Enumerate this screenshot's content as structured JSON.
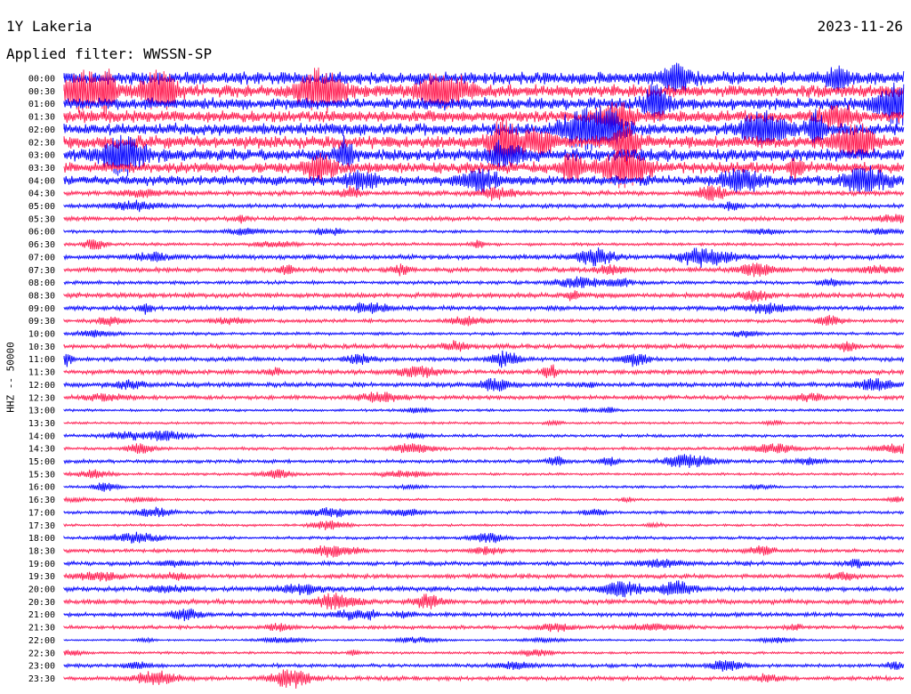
{
  "header": {
    "station": "1Y Lakeria",
    "date": "2023-11-26",
    "filter_label": "Applied filter: WWSSN-SP"
  },
  "colors": {
    "series_a": "#0000ff",
    "series_b": "#ff1a4f",
    "text": "#000000"
  },
  "chart_data": {
    "type": "line",
    "title": "1Y Lakeria",
    "subtitle": "Applied filter: WWSSN-SP",
    "ylabel": "HHZ -- 50000",
    "grid": false,
    "legend": "none",
    "rows": [
      {
        "label": "00:00",
        "activity": 1.0
      },
      {
        "label": "00:30",
        "activity": 1.0
      },
      {
        "label": "01:00",
        "activity": 0.95
      },
      {
        "label": "01:30",
        "activity": 0.95
      },
      {
        "label": "02:00",
        "activity": 0.95
      },
      {
        "label": "02:30",
        "activity": 1.0
      },
      {
        "label": "03:00",
        "activity": 1.0
      },
      {
        "label": "03:30",
        "activity": 0.9
      },
      {
        "label": "04:00",
        "activity": 0.75
      },
      {
        "label": "04:30",
        "activity": 0.3
      },
      {
        "label": "05:00",
        "activity": 0.25
      },
      {
        "label": "05:30",
        "activity": 0.25
      },
      {
        "label": "06:00",
        "activity": 0.15
      },
      {
        "label": "06:30",
        "activity": 0.15
      },
      {
        "label": "07:00",
        "activity": 0.3
      },
      {
        "label": "07:30",
        "activity": 0.3
      },
      {
        "label": "08:00",
        "activity": 0.2
      },
      {
        "label": "08:30",
        "activity": 0.3
      },
      {
        "label": "09:00",
        "activity": 0.3
      },
      {
        "label": "09:30",
        "activity": 0.2
      },
      {
        "label": "10:00",
        "activity": 0.15
      },
      {
        "label": "10:30",
        "activity": 0.3
      },
      {
        "label": "11:00",
        "activity": 0.25
      },
      {
        "label": "11:30",
        "activity": 0.3
      },
      {
        "label": "12:00",
        "activity": 0.3
      },
      {
        "label": "12:30",
        "activity": 0.25
      },
      {
        "label": "13:00",
        "activity": 0.1
      },
      {
        "label": "13:30",
        "activity": 0.1
      },
      {
        "label": "14:00",
        "activity": 0.15
      },
      {
        "label": "14:30",
        "activity": 0.15
      },
      {
        "label": "15:00",
        "activity": 0.2
      },
      {
        "label": "15:30",
        "activity": 0.1
      },
      {
        "label": "16:00",
        "activity": 0.1
      },
      {
        "label": "16:30",
        "activity": 0.1
      },
      {
        "label": "17:00",
        "activity": 0.15
      },
      {
        "label": "17:30",
        "activity": 0.1
      },
      {
        "label": "18:00",
        "activity": 0.15
      },
      {
        "label": "18:30",
        "activity": 0.2
      },
      {
        "label": "19:00",
        "activity": 0.25
      },
      {
        "label": "19:30",
        "activity": 0.25
      },
      {
        "label": "20:00",
        "activity": 0.3
      },
      {
        "label": "20:30",
        "activity": 0.3
      },
      {
        "label": "21:00",
        "activity": 0.25
      },
      {
        "label": "21:30",
        "activity": 0.2
      },
      {
        "label": "22:00",
        "activity": 0.05
      },
      {
        "label": "22:30",
        "activity": 0.1
      },
      {
        "label": "23:00",
        "activity": 0.2
      },
      {
        "label": "23:30",
        "activity": 0.25
      }
    ]
  }
}
